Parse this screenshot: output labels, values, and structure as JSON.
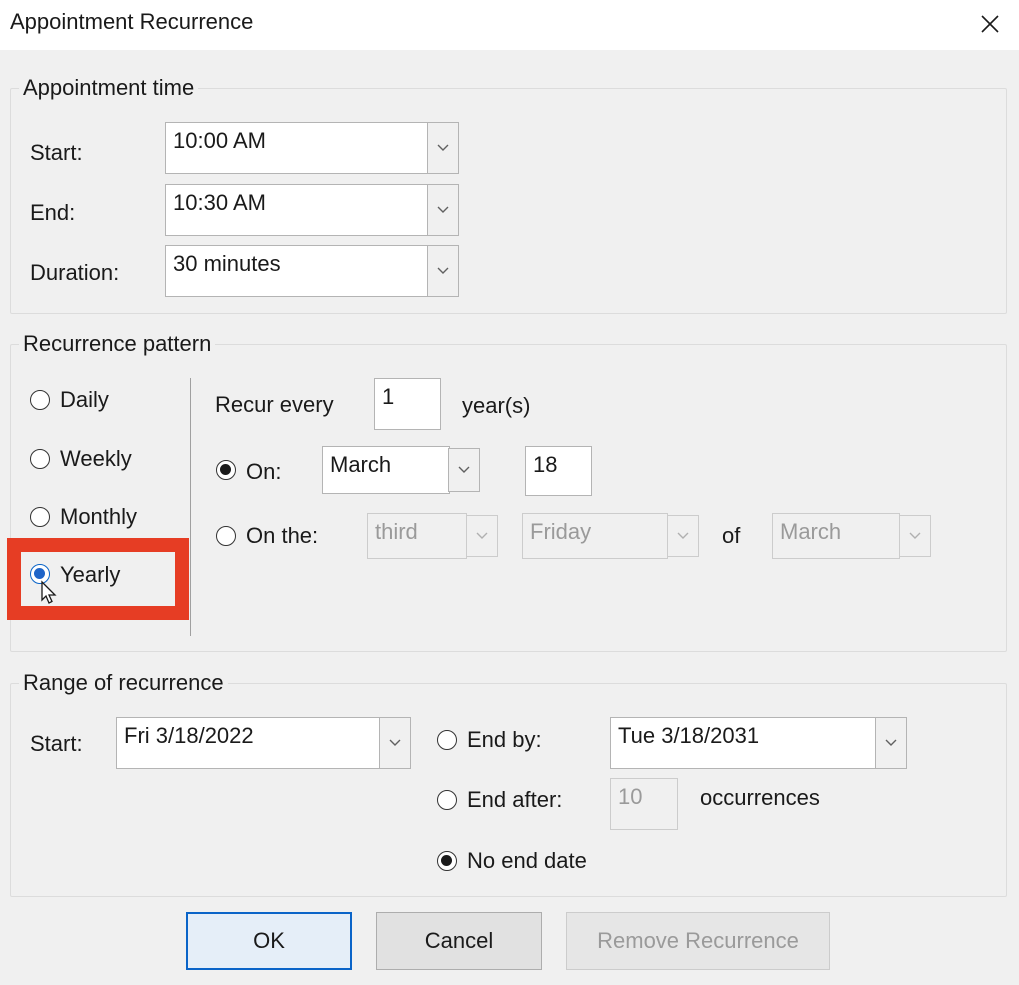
{
  "window": {
    "title": "Appointment Recurrence",
    "close_icon": "close-icon"
  },
  "appointment_time": {
    "label": "Appointment time",
    "start_label": "Start:",
    "start_value": "10:00 AM",
    "end_label": "End:",
    "end_value": "10:30 AM",
    "duration_label": "Duration:",
    "duration_value": "30 minutes"
  },
  "recurrence_pattern": {
    "label": "Recurrence pattern",
    "options": [
      "Daily",
      "Weekly",
      "Monthly",
      "Yearly"
    ],
    "selected": "Yearly",
    "recur_every_label": "Recur every",
    "recur_every_value": "1",
    "recur_unit": "year(s)",
    "on_label": "On:",
    "on_month": "March",
    "on_day": "18",
    "on_the_label": "On the:",
    "on_the_ordinal": "third",
    "on_the_weekday": "Friday",
    "of_label": "of",
    "on_the_month": "March",
    "yearly_mode": "On"
  },
  "range_of_recurrence": {
    "label": "Range of recurrence",
    "start_label": "Start:",
    "start_value": "Fri 3/18/2022",
    "end_by_label": "End by:",
    "end_by_value": "Tue 3/18/2031",
    "end_after_label": "End after:",
    "end_after_value": "10",
    "occurrences_label": "occurrences",
    "no_end_label": "No end date",
    "selected": "No end date"
  },
  "buttons": {
    "ok": "OK",
    "cancel": "Cancel",
    "remove": "Remove Recurrence"
  },
  "colors": {
    "highlight": "#e63d24",
    "accent": "#0a64c8"
  }
}
